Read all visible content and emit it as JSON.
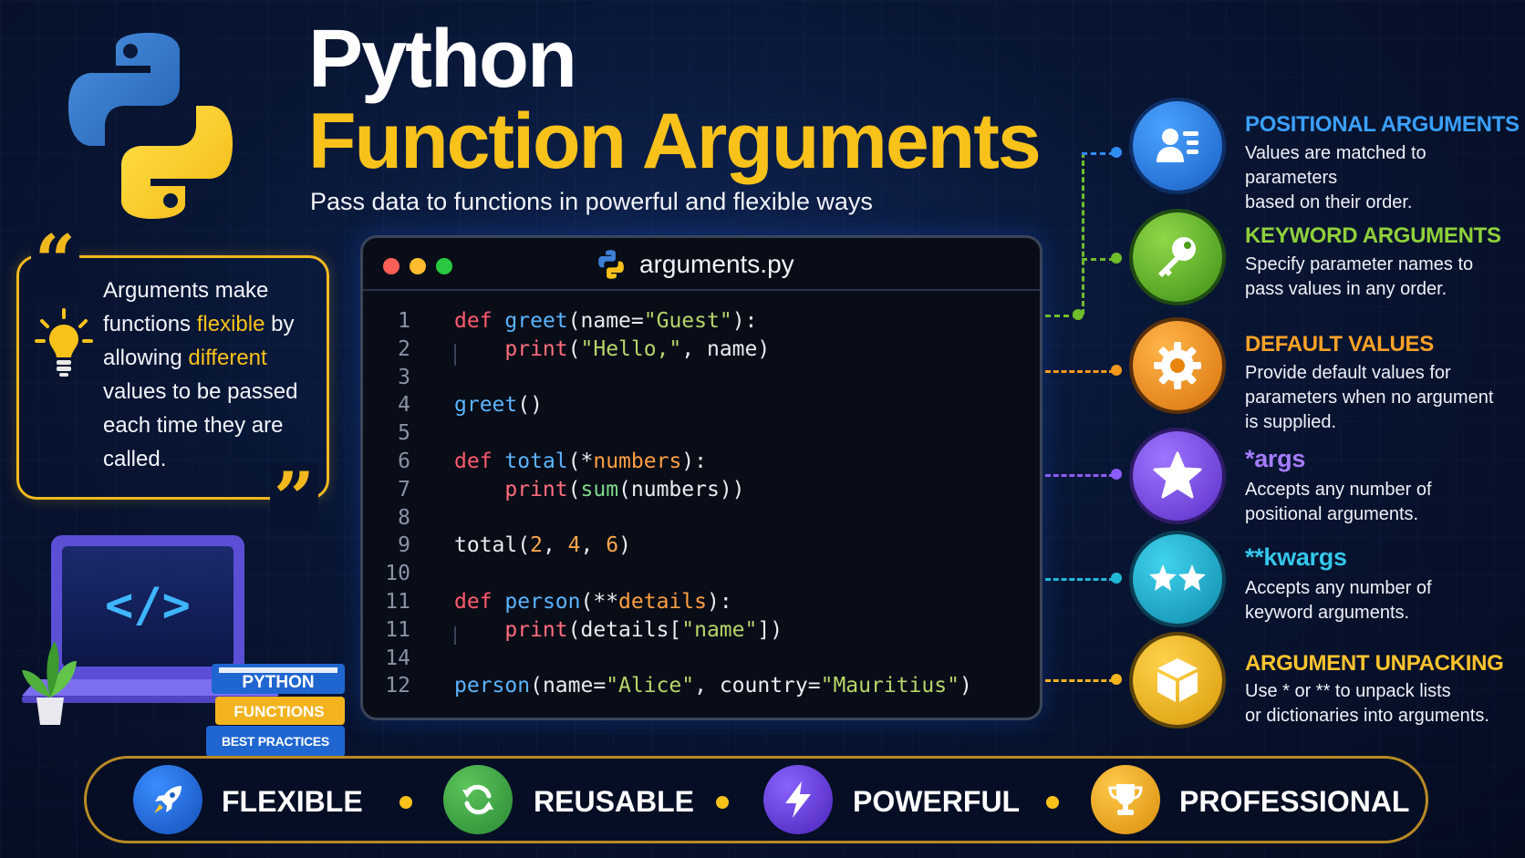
{
  "header": {
    "title_line1": "Python",
    "title_line2": "Function Arguments",
    "subtitle": "Pass data to functions in powerful and flexible ways"
  },
  "quote": {
    "line1": "Arguments make",
    "line2_a": "functions ",
    "line2_b": "flexible",
    "line2_c": " by",
    "line3_a": "allowing ",
    "line3_b": "different",
    "line4": "values to be passed",
    "line5": "each time they are",
    "line6": "called."
  },
  "editor": {
    "filename": "arguments.py",
    "line_numbers": [
      "1",
      "2",
      "3",
      "4",
      "5",
      "6",
      "7",
      "8",
      "9",
      "10",
      "11",
      "11",
      "14",
      "12"
    ]
  },
  "features": [
    {
      "title": "POSITIONAL ARGUMENTS",
      "desc_lines": [
        "Values are matched to parameters",
        "based on their order."
      ],
      "color": "#2f8cf0",
      "icon": "user-list-icon"
    },
    {
      "title": "KEYWORD ARGUMENTS",
      "desc_lines": [
        "Specify parameter names to",
        "pass values in any order."
      ],
      "color": "#6fbd2a",
      "icon": "key-icon"
    },
    {
      "title": "DEFAULT VALUES",
      "desc_lines": [
        "Provide default values for",
        "parameters when no argument",
        "is supplied."
      ],
      "color": "#f39a1c",
      "icon": "gear-icon"
    },
    {
      "title": "*args",
      "desc_lines": [
        "Accepts any number of",
        "positional arguments."
      ],
      "color": "#8b5cf6",
      "icon": "star-icon"
    },
    {
      "title": "**kwargs",
      "desc_lines": [
        "Accepts any number of",
        "keyword arguments."
      ],
      "color": "#1fb8d8",
      "icon": "double-star-icon"
    },
    {
      "title": "ARGUMENT UNPACKING",
      "desc_lines": [
        "Use * or ** to unpack lists",
        "or dictionaries into arguments."
      ],
      "color": "#f2b31e",
      "icon": "box-icon"
    }
  ],
  "books": {
    "top": "PYTHON",
    "middle": "FUNCTIONS",
    "bottom": "BEST PRACTICES"
  },
  "bottom_bar": [
    {
      "label": "FLEXIBLE",
      "icon": "rocket-icon",
      "color": "#1f6fd8"
    },
    {
      "label": "REUSABLE",
      "icon": "refresh-icon",
      "color": "#3aa84a"
    },
    {
      "label": "POWERFUL",
      "icon": "lightning-icon",
      "color": "#6d3fd8"
    },
    {
      "label": "PROFESSIONAL",
      "icon": "trophy-icon",
      "color": "#f2a81e"
    }
  ]
}
